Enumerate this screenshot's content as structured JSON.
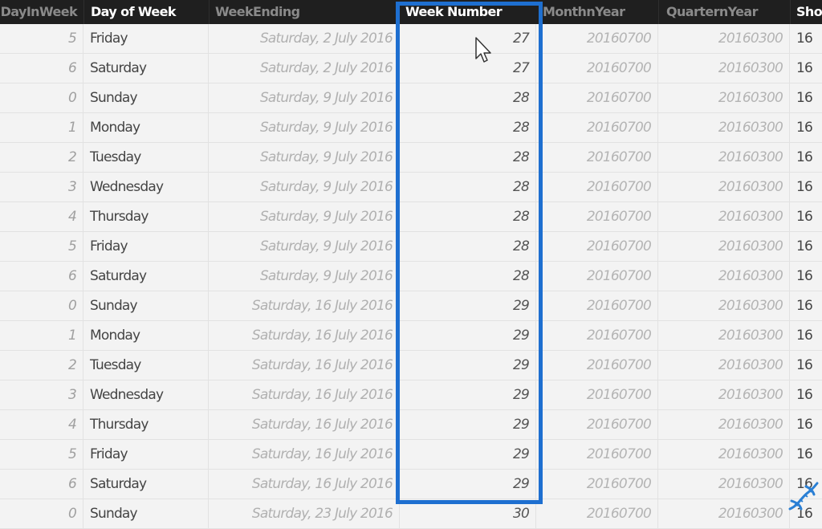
{
  "table": {
    "columns": [
      {
        "key": "dayinweek",
        "label": "DayInWeek"
      },
      {
        "key": "day",
        "label": "Day of Week"
      },
      {
        "key": "weekending",
        "label": "WeekEnding"
      },
      {
        "key": "weeknumber",
        "label": "Week Number",
        "selected": true
      },
      {
        "key": "monthyear",
        "label": "MonthnYear"
      },
      {
        "key": "quarteryear",
        "label": "QuarternYear"
      },
      {
        "key": "short",
        "label": "ShortYear"
      }
    ],
    "rows": [
      {
        "dayinweek": "5",
        "day": "Friday",
        "weekending": "Saturday, 2 July 2016",
        "weeknumber": "27",
        "monthyear": "20160700",
        "quarteryear": "20160300",
        "short": "16"
      },
      {
        "dayinweek": "6",
        "day": "Saturday",
        "weekending": "Saturday, 2 July 2016",
        "weeknumber": "27",
        "monthyear": "20160700",
        "quarteryear": "20160300",
        "short": "16"
      },
      {
        "dayinweek": "0",
        "day": "Sunday",
        "weekending": "Saturday, 9 July 2016",
        "weeknumber": "28",
        "monthyear": "20160700",
        "quarteryear": "20160300",
        "short": "16"
      },
      {
        "dayinweek": "1",
        "day": "Monday",
        "weekending": "Saturday, 9 July 2016",
        "weeknumber": "28",
        "monthyear": "20160700",
        "quarteryear": "20160300",
        "short": "16"
      },
      {
        "dayinweek": "2",
        "day": "Tuesday",
        "weekending": "Saturday, 9 July 2016",
        "weeknumber": "28",
        "monthyear": "20160700",
        "quarteryear": "20160300",
        "short": "16"
      },
      {
        "dayinweek": "3",
        "day": "Wednesday",
        "weekending": "Saturday, 9 July 2016",
        "weeknumber": "28",
        "monthyear": "20160700",
        "quarteryear": "20160300",
        "short": "16"
      },
      {
        "dayinweek": "4",
        "day": "Thursday",
        "weekending": "Saturday, 9 July 2016",
        "weeknumber": "28",
        "monthyear": "20160700",
        "quarteryear": "20160300",
        "short": "16"
      },
      {
        "dayinweek": "5",
        "day": "Friday",
        "weekending": "Saturday, 9 July 2016",
        "weeknumber": "28",
        "monthyear": "20160700",
        "quarteryear": "20160300",
        "short": "16"
      },
      {
        "dayinweek": "6",
        "day": "Saturday",
        "weekending": "Saturday, 9 July 2016",
        "weeknumber": "28",
        "monthyear": "20160700",
        "quarteryear": "20160300",
        "short": "16"
      },
      {
        "dayinweek": "0",
        "day": "Sunday",
        "weekending": "Saturday, 16 July 2016",
        "weeknumber": "29",
        "monthyear": "20160700",
        "quarteryear": "20160300",
        "short": "16"
      },
      {
        "dayinweek": "1",
        "day": "Monday",
        "weekending": "Saturday, 16 July 2016",
        "weeknumber": "29",
        "monthyear": "20160700",
        "quarteryear": "20160300",
        "short": "16"
      },
      {
        "dayinweek": "2",
        "day": "Tuesday",
        "weekending": "Saturday, 16 July 2016",
        "weeknumber": "29",
        "monthyear": "20160700",
        "quarteryear": "20160300",
        "short": "16"
      },
      {
        "dayinweek": "3",
        "day": "Wednesday",
        "weekending": "Saturday, 16 July 2016",
        "weeknumber": "29",
        "monthyear": "20160700",
        "quarteryear": "20160300",
        "short": "16"
      },
      {
        "dayinweek": "4",
        "day": "Thursday",
        "weekending": "Saturday, 16 July 2016",
        "weeknumber": "29",
        "monthyear": "20160700",
        "quarteryear": "20160300",
        "short": "16"
      },
      {
        "dayinweek": "5",
        "day": "Friday",
        "weekending": "Saturday, 16 July 2016",
        "weeknumber": "29",
        "monthyear": "20160700",
        "quarteryear": "20160300",
        "short": "16"
      },
      {
        "dayinweek": "6",
        "day": "Saturday",
        "weekending": "Saturday, 16 July 2016",
        "weeknumber": "29",
        "monthyear": "20160700",
        "quarteryear": "20160300",
        "short": "16"
      },
      {
        "dayinweek": "0",
        "day": "Sunday",
        "weekending": "Saturday, 23 July 2016",
        "weeknumber": "30",
        "monthyear": "20160700",
        "quarteryear": "20160300",
        "short": "16"
      }
    ]
  },
  "colors": {
    "highlight": "#1e6fd0",
    "header_bg": "#1f1f1f",
    "watermark": "#2a7fd4"
  }
}
